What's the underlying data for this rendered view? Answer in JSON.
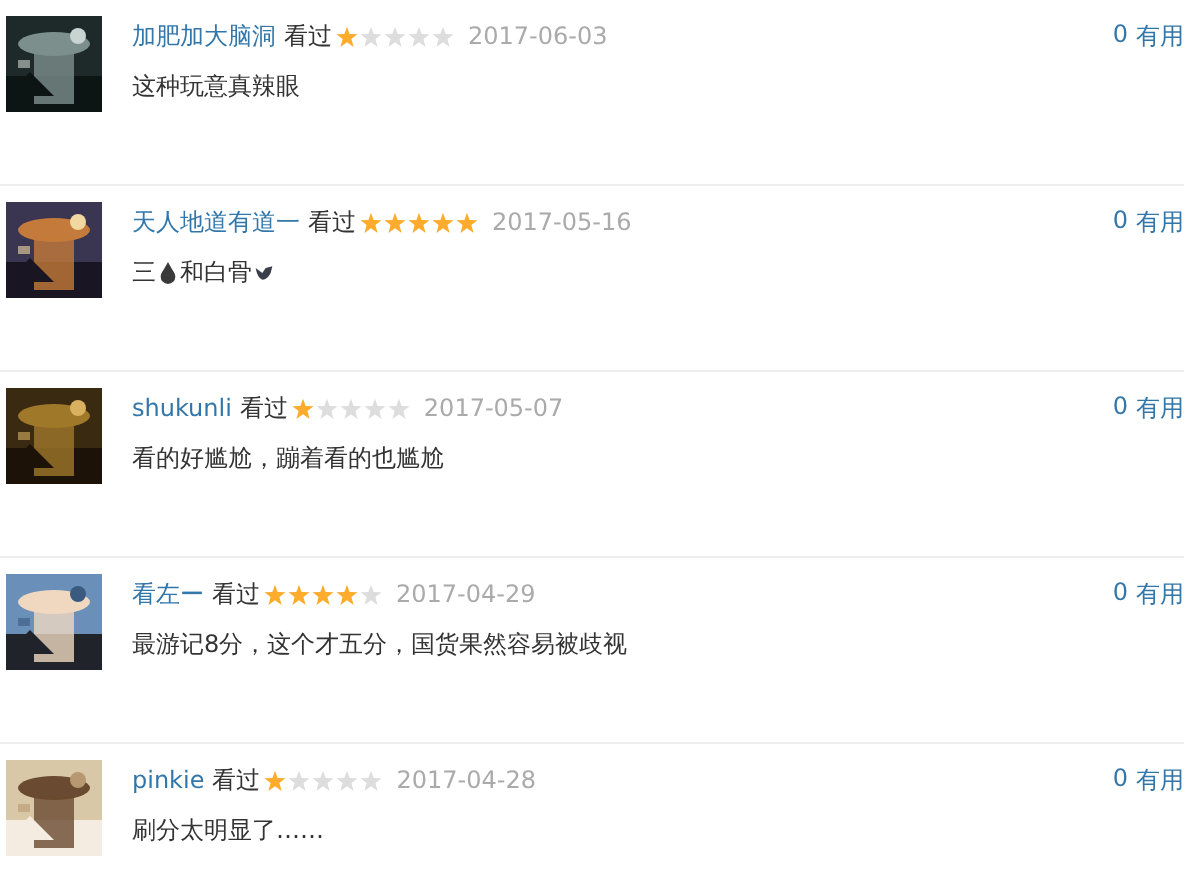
{
  "comments": [
    {
      "avatar": {
        "kind": "picture"
      },
      "user": "加肥加大脑洞",
      "status": "看过",
      "stars": 1,
      "date": "2017-06-03",
      "comment": [
        {
          "kind": "text",
          "text": "这种玩意真辣眼"
        }
      ],
      "votes": "0",
      "votes_label": "有用"
    },
    {
      "avatar": {
        "kind": "picture"
      },
      "user": "天人地道有道一",
      "status": "看过",
      "stars": 5,
      "date": "2017-05-16",
      "comment": [
        {
          "kind": "text",
          "text": "三"
        },
        {
          "kind": "drop"
        },
        {
          "kind": "text",
          "text": "和白骨"
        },
        {
          "kind": "bird"
        }
      ],
      "votes": "0",
      "votes_label": "有用"
    },
    {
      "avatar": {
        "kind": "picture"
      },
      "user": "shukunli",
      "status": "看过",
      "stars": 1,
      "date": "2017-05-07",
      "comment": [
        {
          "kind": "text",
          "text": "看的好尴尬，蹦着看的也尴尬"
        }
      ],
      "votes": "0",
      "votes_label": "有用"
    },
    {
      "avatar": {
        "kind": "picture"
      },
      "user": "看左ー",
      "status": "看过",
      "stars": 4,
      "date": "2017-04-29",
      "comment": [
        {
          "kind": "text",
          "text": "最游记8分，这个才五分，国货果然容易被歧视"
        }
      ],
      "votes": "0",
      "votes_label": "有用"
    },
    {
      "avatar": {
        "kind": "picture"
      },
      "user": "pinkie",
      "status": "看过",
      "stars": 1,
      "date": "2017-04-28",
      "comment": [
        {
          "kind": "text",
          "text": "刷分太明显了……"
        }
      ],
      "votes": "0",
      "votes_label": "有用"
    }
  ]
}
